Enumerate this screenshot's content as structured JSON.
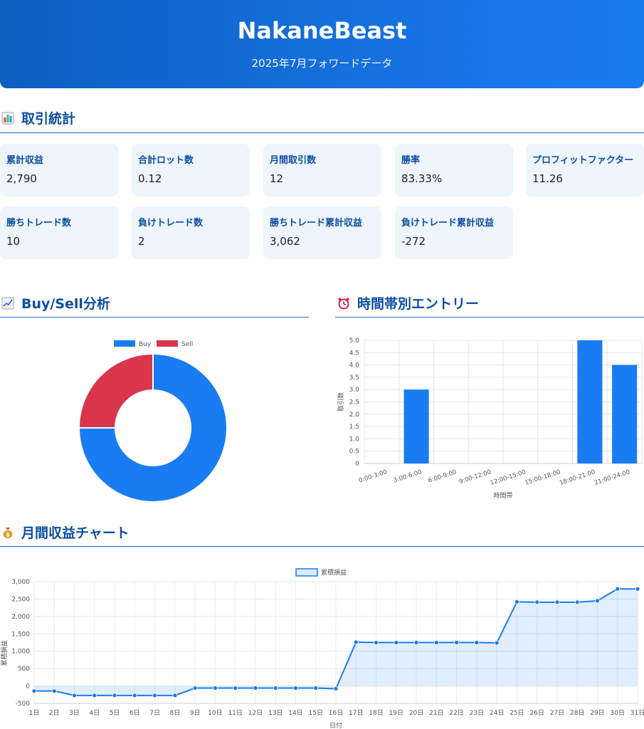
{
  "header": {
    "title": "NakaneBeast",
    "subtitle": "2025年7月フォワードデータ"
  },
  "stats_section": {
    "title": "取引統計",
    "icon": "bar-chart-icon",
    "cards": [
      {
        "label": "累計収益",
        "value": "2,790"
      },
      {
        "label": "合計ロット数",
        "value": "0.12"
      },
      {
        "label": "月間取引数",
        "value": "12"
      },
      {
        "label": "勝率",
        "value": "83.33%"
      },
      {
        "label": "プロフィットファクター",
        "value": "11.26"
      },
      {
        "label": "勝ちトレード数",
        "value": "10"
      },
      {
        "label": "負けトレード数",
        "value": "2"
      },
      {
        "label": "勝ちトレード累計収益",
        "value": "3,062"
      },
      {
        "label": "負けトレード累計収益",
        "value": "-272"
      }
    ]
  },
  "buysell_section": {
    "title": "Buy/Sell分析",
    "icon": "line-chart-icon"
  },
  "hourly_section": {
    "title": "時間帯別エントリー",
    "icon": "alarm-clock-icon"
  },
  "monthly_section": {
    "title": "月間収益チャート",
    "icon": "money-bag-icon"
  },
  "colors": {
    "accent": "#1a7cf2",
    "buy": "#1a7cf2",
    "sell": "#d9364b",
    "heading": "#0d4fa0",
    "card_bg": "#eef5fd"
  },
  "chart_data": [
    {
      "type": "pie",
      "variant": "doughnut",
      "legend_position": "top",
      "categories": [
        "Buy",
        "Sell"
      ],
      "values": [
        9,
        3
      ]
    },
    {
      "type": "bar",
      "categories": [
        "0:00-3:00",
        "3:00-6:00",
        "6:00-9:00",
        "9:00-12:00",
        "12:00-15:00",
        "15:00-18:00",
        "18:00-21:00",
        "21:00-24:00"
      ],
      "values": [
        0,
        3,
        0,
        0,
        0,
        0,
        5,
        4
      ],
      "xlabel": "時間帯",
      "ylabel": "取引数",
      "ylim": [
        0,
        5
      ],
      "yticks": [
        "0",
        "0.5",
        "1.0",
        "1.5",
        "2.0",
        "2.5",
        "3.0",
        "3.5",
        "4.0",
        "4.5",
        "5.0"
      ],
      "grid": true
    },
    {
      "type": "area",
      "legend_position": "top",
      "series": [
        {
          "name": "累積損益",
          "values": [
            -145,
            -145,
            -272,
            -272,
            -272,
            -272,
            -272,
            -272,
            -60,
            -60,
            -60,
            -60,
            -60,
            -60,
            -60,
            -80,
            1260,
            1250,
            1250,
            1250,
            1250,
            1250,
            1250,
            1240,
            2420,
            2410,
            2410,
            2410,
            2450,
            2790,
            2790
          ]
        }
      ],
      "categories": [
        "1日",
        "2日",
        "3日",
        "4日",
        "5日",
        "6日",
        "7日",
        "8日",
        "9日",
        "10日",
        "11日",
        "12日",
        "13日",
        "14日",
        "15日",
        "16日",
        "17日",
        "18日",
        "19日",
        "20日",
        "21日",
        "22日",
        "23日",
        "24日",
        "25日",
        "26日",
        "27日",
        "28日",
        "29日",
        "30日",
        "31日"
      ],
      "xlabel": "日付",
      "ylabel": "累積損益",
      "ylim": [
        -500,
        3000
      ],
      "yticks": [
        "-500",
        "0",
        "500",
        "1,000",
        "1,500",
        "2,000",
        "2,500",
        "3,000"
      ],
      "grid": true
    }
  ]
}
